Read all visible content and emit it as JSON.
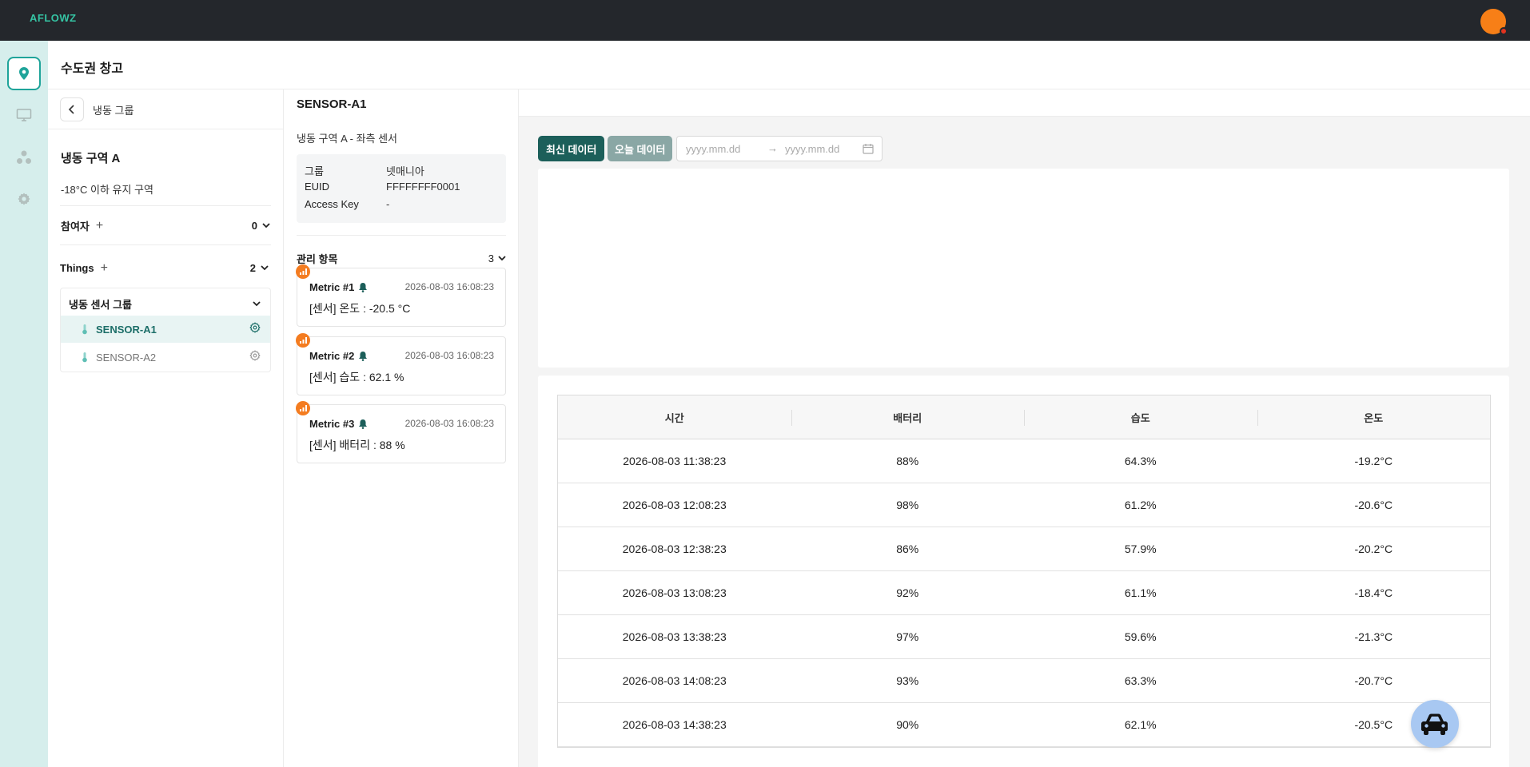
{
  "app": {
    "logo": "AFLOWZ",
    "accent": "#1fa49a",
    "brand_orange": "#f77f17"
  },
  "nav": [
    {
      "icon": "map-pin-icon",
      "active": true
    },
    {
      "icon": "monitor-icon",
      "active": false
    },
    {
      "icon": "nodes-icon",
      "active": false
    },
    {
      "icon": "gear-icon",
      "active": false
    }
  ],
  "header": {
    "title": "수도권 창고"
  },
  "group_panel": {
    "back_label": "냉동 그룹",
    "zone_title": "냉동 구역 A",
    "zone_desc": "-18°C 이하 유지 구역",
    "participants": {
      "label": "참여자",
      "count": "0"
    },
    "things": {
      "label": "Things",
      "count": "2"
    },
    "sensor_group": {
      "name": "냉동 센서 그룹",
      "sensors": [
        {
          "name": "SENSOR-A1",
          "active": true
        },
        {
          "name": "SENSOR-A2",
          "active": false
        }
      ]
    }
  },
  "device_panel": {
    "title": "SENSOR-A1",
    "subtitle": "냉동 구역 A - 좌측 센서",
    "info": [
      {
        "key": "그룹",
        "value": "넷매니아"
      },
      {
        "key": "EUID",
        "value": "FFFFFFFF0001"
      },
      {
        "key": "Access Key",
        "value": "-"
      }
    ],
    "management": {
      "label": "관리 항목",
      "count": "3"
    },
    "metrics": [
      {
        "name": "Metric #1",
        "time": "2026-08-03 16:08:23",
        "value": "[센서] 온도 : -20.5 °C"
      },
      {
        "name": "Metric #2",
        "time": "2026-08-03 16:08:23",
        "value": "[센서] 습도 : 62.1 %"
      },
      {
        "name": "Metric #3",
        "time": "2026-08-03 16:08:23",
        "value": "[센서] 배터리 : 88 %"
      }
    ]
  },
  "data_view": {
    "btn_latest": "최신 데이터",
    "btn_today": "오늘 데이터",
    "date_start_placeholder": "yyyy.mm.dd",
    "date_end_placeholder": "yyyy.mm.dd",
    "date_separator": "→",
    "table": {
      "columns": [
        "시간",
        "배터리",
        "습도",
        "온도"
      ],
      "rows": [
        [
          "2026-08-03 11:38:23",
          "88%",
          "64.3%",
          "-19.2°C"
        ],
        [
          "2026-08-03 12:08:23",
          "98%",
          "61.2%",
          "-20.6°C"
        ],
        [
          "2026-08-03 12:38:23",
          "86%",
          "57.9%",
          "-20.2°C"
        ],
        [
          "2026-08-03 13:08:23",
          "92%",
          "61.1%",
          "-18.4°C"
        ],
        [
          "2026-08-03 13:38:23",
          "97%",
          "59.6%",
          "-21.3°C"
        ],
        [
          "2026-08-03 14:08:23",
          "93%",
          "63.3%",
          "-20.7°C"
        ],
        [
          "2026-08-03 14:38:23",
          "90%",
          "62.1%",
          "-20.5°C"
        ]
      ]
    }
  }
}
